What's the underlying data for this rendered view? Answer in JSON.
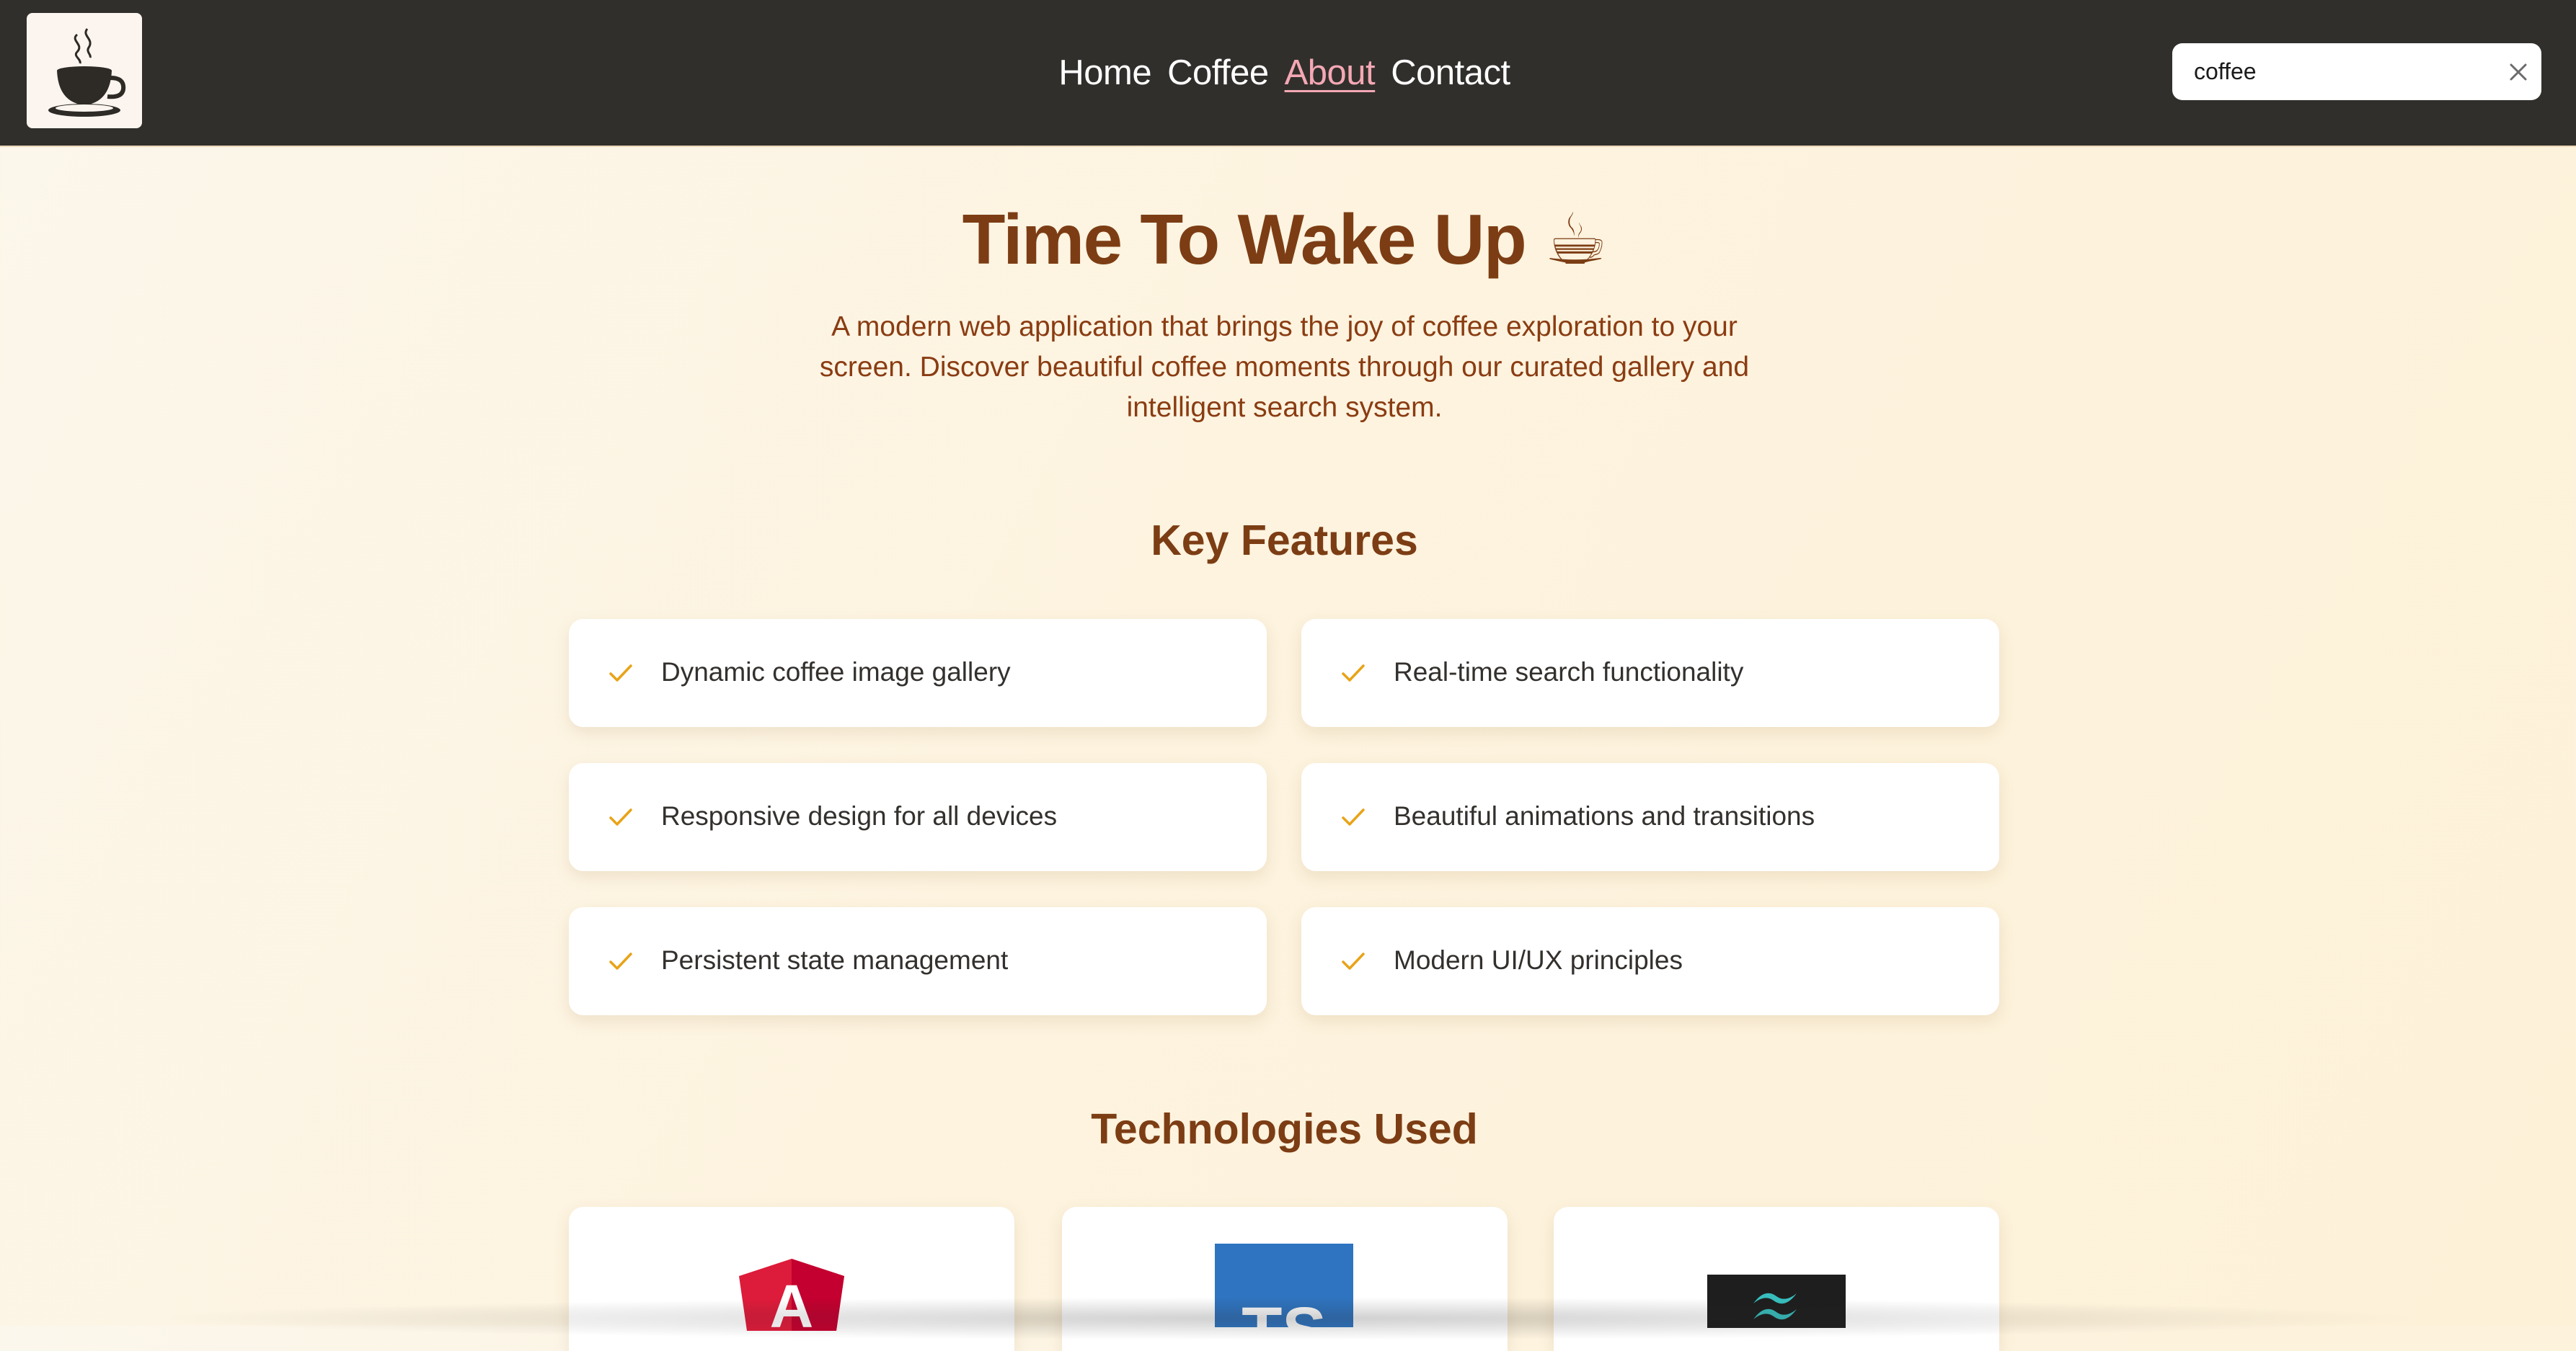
{
  "header": {
    "logo_icon": "coffee-cup-icon",
    "nav": [
      {
        "label": "Home",
        "active": false
      },
      {
        "label": "Coffee",
        "active": false
      },
      {
        "label": "About",
        "active": true
      },
      {
        "label": "Contact",
        "active": false
      }
    ],
    "search": {
      "value": "coffee",
      "clear_icon": "close-icon"
    }
  },
  "hero": {
    "title": "Time To Wake Up ☕",
    "description": "A modern web application that brings the joy of coffee exploration to your screen. Discover beautiful coffee moments through our curated gallery and intelligent search system."
  },
  "features": {
    "title": "Key Features",
    "icon": "check-icon",
    "items": [
      "Dynamic coffee image gallery",
      "Real-time search functionality",
      "Responsive design for all devices",
      "Beautiful animations and transitions",
      "Persistent state management",
      "Modern UI/UX principles"
    ]
  },
  "technologies": {
    "title": "Technologies Used",
    "items": [
      {
        "icon": "angular-logo-icon",
        "badge": "A"
      },
      {
        "icon": "typescript-logo-icon",
        "badge": "TS"
      },
      {
        "icon": "tailwind-logo-icon"
      }
    ]
  },
  "colors": {
    "nav_bg": "#312f2c",
    "accent_link": "#f4a8b4",
    "heading": "#7c3d14",
    "check": "#e8a317"
  }
}
